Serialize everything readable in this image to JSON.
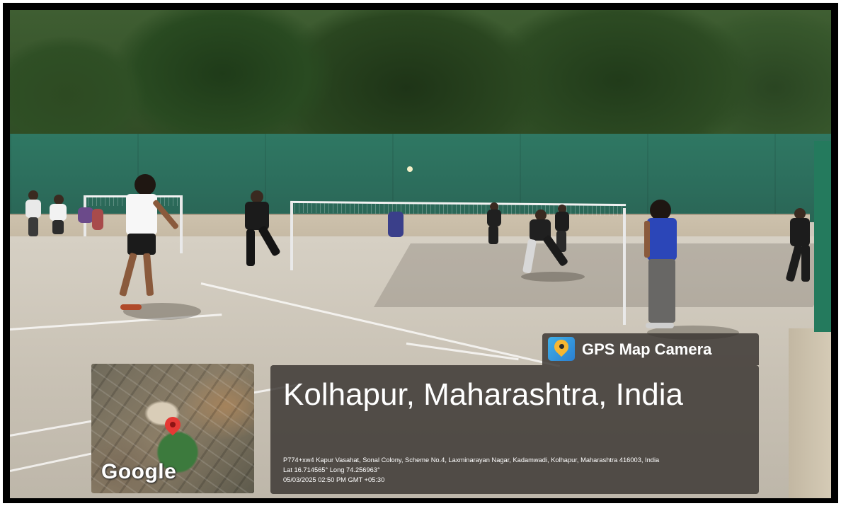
{
  "overlay": {
    "brand": "GPS Map Camera",
    "title": "Kolhapur, Maharashtra, India",
    "address": "P774+xw4 Kapur Vasahat, Sonal Colony, Scheme No.4, Laxminarayan Nagar, Kadamwadi, Kolhapur, Maharashtra 416003, India",
    "coords": "Lat 16.714565° Long 74.256963°",
    "datetime": "05/03/2025 02:50 PM GMT +05:30",
    "map_label": "Google",
    "icons": [
      "gps-map-camera-icon",
      "map-pin-icon"
    ],
    "colors": {
      "overlay_bg": "#3a3632",
      "pin": "#e53935"
    }
  }
}
